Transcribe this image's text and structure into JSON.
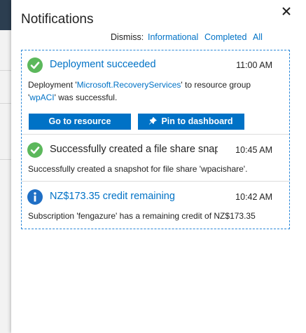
{
  "panel": {
    "title": "Notifications",
    "dismiss": {
      "label": "Dismiss:",
      "links": [
        "Informational",
        "Completed",
        "All"
      ]
    }
  },
  "notifications": [
    {
      "icon": "check-circle-icon",
      "title": "Deployment succeeded",
      "time": "11:00 AM",
      "body": {
        "t1": "Deployment '",
        "link1": "Microsoft.RecoveryServices",
        "t2": "' to resource group",
        "t3": "'",
        "link2": "wpACI",
        "t4": "' was successful."
      },
      "buttons": {
        "go": "Go to resource",
        "pin": "Pin to dashboard"
      }
    },
    {
      "icon": "check-circle-icon",
      "title": "Successfully created a file share snaps...",
      "time": "10:45 AM",
      "body": "Successfully created a snapshot for file share 'wpacishare'."
    },
    {
      "icon": "info-circle-icon",
      "title": "NZ$173.35 credit remaining",
      "time": "10:42 AM",
      "body": "Subscription 'fengazure' has a remaining credit of NZ$173.35"
    }
  ],
  "colors": {
    "accent": "#0072c6",
    "success": "#5cb85c",
    "info": "#1f6fc5"
  }
}
